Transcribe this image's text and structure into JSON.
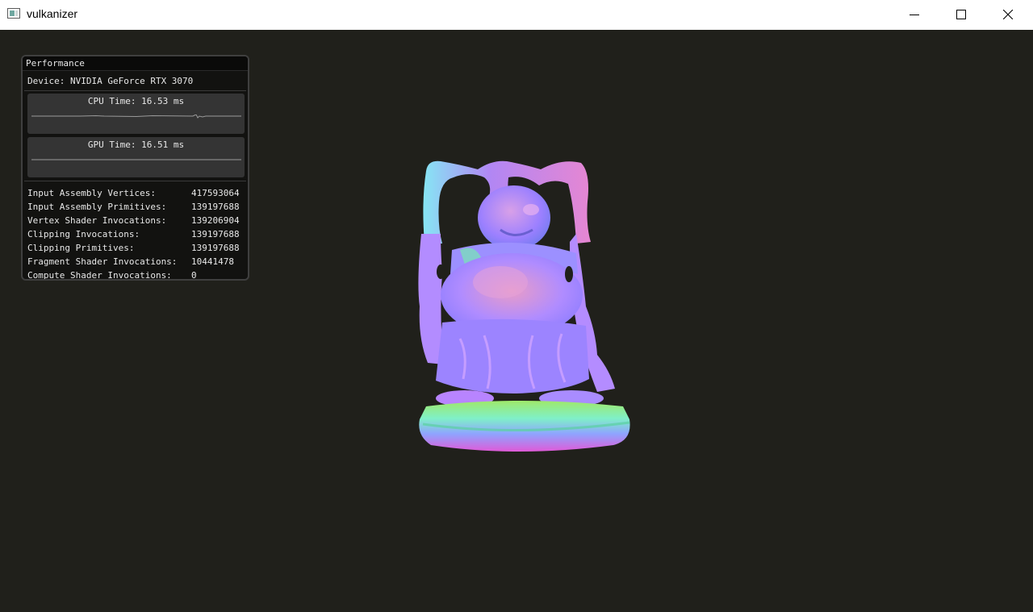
{
  "window": {
    "title": "vulkanizer",
    "controls": [
      "minimize-icon",
      "maximize-icon",
      "close-icon"
    ]
  },
  "panel": {
    "title": "Performance",
    "device": "Device: NVIDIA GeForce RTX 3070",
    "cpu_label": "CPU Time: 16.53 ms",
    "gpu_label": "GPU Time: 16.51 ms",
    "stats": [
      {
        "label": "Input Assembly Vertices:",
        "value": "417593064"
      },
      {
        "label": "Input Assembly Primitives:",
        "value": "139197688"
      },
      {
        "label": "Vertex Shader Invocations:",
        "value": "139206904"
      },
      {
        "label": "Clipping Invocations:",
        "value": "139197688"
      },
      {
        "label": "Clipping Primitives:",
        "value": "139197688"
      },
      {
        "label": "Fragment Shader Invocations:",
        "value": "10441478"
      },
      {
        "label": "Compute Shader Invocations:",
        "value": "0"
      }
    ]
  },
  "colors": {
    "viewport_bg": "#20201b",
    "panel_bg": "#121210",
    "graph_bg": "#343434",
    "graph_line": "#9a9a9a"
  }
}
